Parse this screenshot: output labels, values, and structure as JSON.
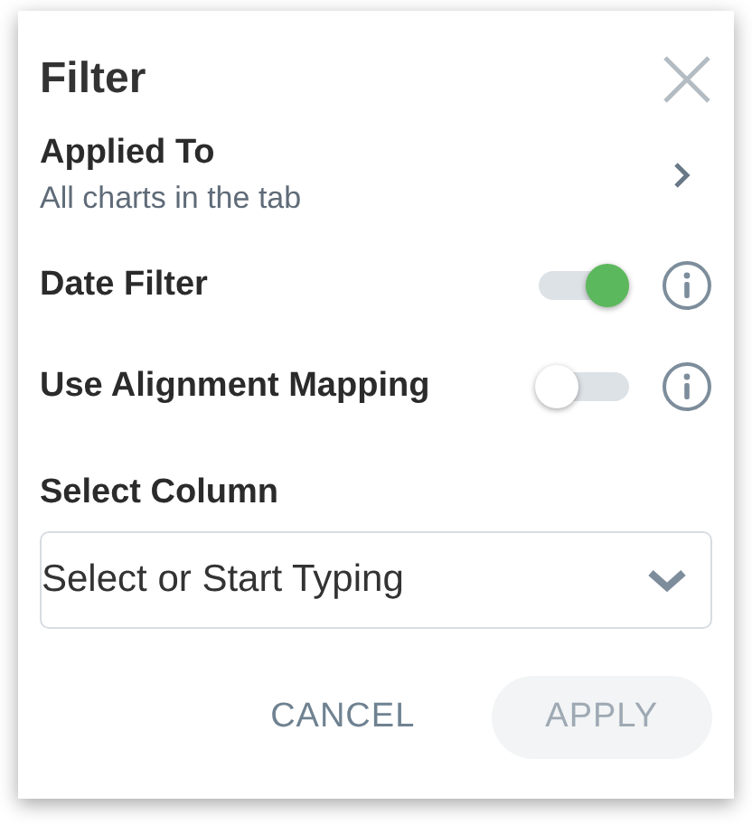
{
  "dialog": {
    "title": "Filter"
  },
  "applied_to": {
    "label": "Applied To",
    "value": "All charts in the tab"
  },
  "toggles": [
    {
      "label": "Date Filter",
      "on": true
    },
    {
      "label": "Use Alignment Mapping",
      "on": false
    }
  ],
  "column": {
    "label": "Select Column",
    "placeholder": "Select or Start Typing"
  },
  "buttons": [
    {
      "label": "CANCEL",
      "kind": "text",
      "disabled": false
    },
    {
      "label": "APPLY",
      "kind": "primary",
      "disabled": true
    }
  ]
}
